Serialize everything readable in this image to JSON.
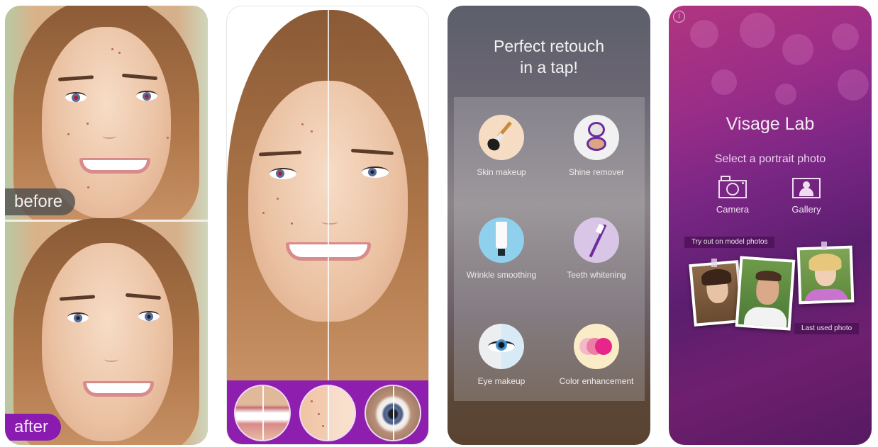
{
  "panel1": {
    "before_label": "before",
    "after_label": "after"
  },
  "panel2": {
    "comparison_circles": [
      {
        "name": "teeth-comparison"
      },
      {
        "name": "skin-comparison"
      },
      {
        "name": "eye-comparison"
      }
    ]
  },
  "panel3": {
    "title_line1": "Perfect retouch",
    "title_line2": "in a tap!",
    "features": [
      {
        "label": "Skin makeup",
        "icon": "makeup-brush-icon",
        "color": "#f7dcc4"
      },
      {
        "label": "Shine remover",
        "icon": "powder-compact-icon",
        "color": "#f1f1f1"
      },
      {
        "label": "Wrinkle smoothing",
        "icon": "cream-tube-icon",
        "color": "#8fd0ec"
      },
      {
        "label": "Teeth whitening",
        "icon": "toothbrush-icon",
        "color": "#d9c6e6"
      },
      {
        "label": "Eye makeup",
        "icon": "eye-icon",
        "color": "#eef2f6"
      },
      {
        "label": "Color enhancement",
        "icon": "color-circles-icon",
        "color": "#fbecc8"
      }
    ]
  },
  "panel4": {
    "info_glyph": "i",
    "app_title": "Visage Lab",
    "subtitle": "Select a portrait photo",
    "camera_label": "Camera",
    "gallery_label": "Gallery",
    "model_photos_callout": "Try out on model photos",
    "last_used_callout": "Last used photo"
  },
  "colors": {
    "accent_purple": "#8a1bb0",
    "panel4_bg": "#7a2685"
  }
}
